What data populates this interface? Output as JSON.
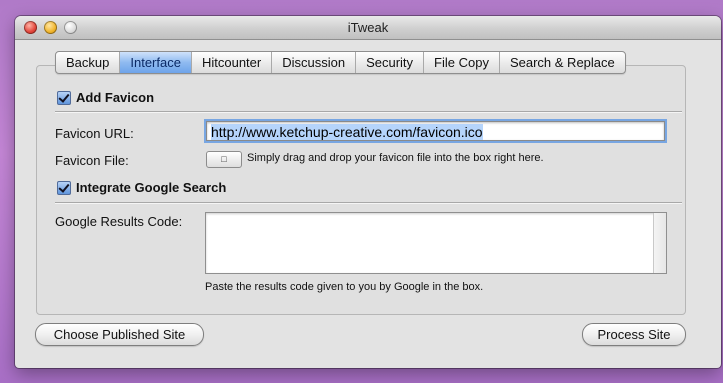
{
  "window": {
    "title": "iTweak"
  },
  "tabs": [
    {
      "label": "Backup"
    },
    {
      "label": "Interface"
    },
    {
      "label": "Hitcounter"
    },
    {
      "label": "Discussion"
    },
    {
      "label": "Security"
    },
    {
      "label": "File Copy"
    },
    {
      "label": "Search & Replace"
    }
  ],
  "favicon": {
    "section_label": "Add Favicon",
    "url_label": "Favicon URL:",
    "url_value": "http://www.ketchup-creative.com/favicon.ico",
    "file_label": "Favicon File:",
    "file_hint": "Simply drag and drop your favicon file into the box right here."
  },
  "google": {
    "section_label": "Integrate Google Search",
    "results_label": "Google Results Code:",
    "results_value": "",
    "results_hint": "Paste the results code given to you by Google in the box."
  },
  "buttons": {
    "choose_site": "Choose Published Site",
    "process_site": "Process Site"
  },
  "active_tab": "Interface",
  "colors": {
    "accent": "#6ea4ea",
    "selection": "#b5d4fb"
  },
  "icons": [
    "close-icon",
    "minimize-icon",
    "zoom-icon",
    "checkbox-checked-icon",
    "file-drop-icon"
  ]
}
